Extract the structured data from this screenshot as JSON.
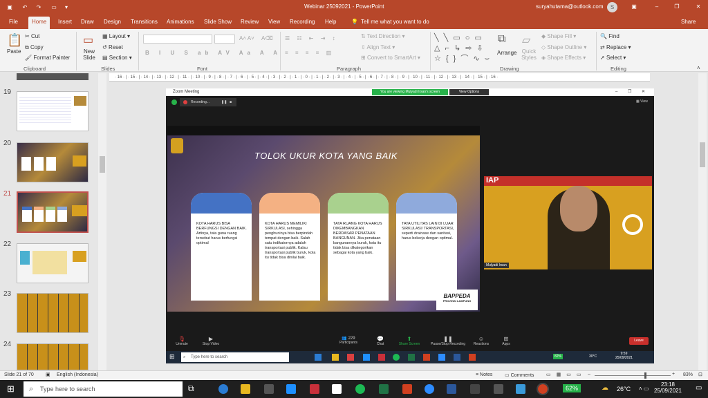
{
  "window": {
    "title": "Webinar 25092021  -  PowerPoint",
    "user": "suryahutama@outlook.com",
    "avatar": "S"
  },
  "tabs": [
    "File",
    "Home",
    "Insert",
    "Draw",
    "Design",
    "Transitions",
    "Animations",
    "Slide Show",
    "Review",
    "View",
    "Recording",
    "Help"
  ],
  "tell_me": "Tell me what you want to do",
  "share": "Share",
  "clipboard": {
    "paste": "Paste",
    "cut": "Cut",
    "copy": "Copy",
    "painter": "Format Painter",
    "label": "Clipboard"
  },
  "slides": {
    "new": "New Slide",
    "layout": "Layout",
    "reset": "Reset",
    "section": "Section",
    "label": "Slides"
  },
  "font_label": "Font",
  "paragraph": {
    "dir": "Text Direction",
    "align": "Align Text",
    "smart": "Convert to SmartArt",
    "label": "Paragraph"
  },
  "drawing": {
    "arrange": "Arrange",
    "quick": "Quick Styles",
    "fill": "Shape Fill",
    "outline": "Shape Outline",
    "effects": "Shape Effects",
    "label": "Drawing"
  },
  "editing": {
    "find": "Find",
    "replace": "Replace",
    "select": "Select",
    "label": "Editing"
  },
  "ruler": "· 16 · | · 15 · | · 14 · | · 13 · | · 12 · | · 11 · | · 10 · | · 9 · | · 8 · | · 7 · | · 6 · | · 5 · | · 4 · | · 3 · | · 2 · | · 1 · | · 0 · | · 1 · | · 2 · | · 3 · | · 4 · | · 5 · | · 6 · | · 7 · | · 8 · | · 9 · | · 10 · | · 11 · | · 12 · | · 13 · | · 14 · | · 15 · | · 16 ·",
  "thumbnails": [
    "19",
    "20",
    "21",
    "22",
    "23",
    "24"
  ],
  "zoom": {
    "title": "Zoom Meeting",
    "viewing": "You are viewing Mulyadi Irsan's screen",
    "options": "View Options",
    "recording": "Recording...",
    "view": "View",
    "slide_title": "TOLOK UKUR KOTA YANG BAIK",
    "card1": "KOTA HARUS BISA BERFUNGSI DENGAN BAIK. Artinya, tata guna ruang tersebut harus berfungsi optimal",
    "card2": "KOTA HARUS MEMILIKI SIRKULASI, sehingga penghuninya bisa berpindah tempat dengan baik. Salah satu indikatornya adalah transportasi publik. Kalau transportasi publik buruk, kota itu tidak bisa dinilai baik.",
    "card3": "TATA RUANG KOTA HARUS DIKEMBANGKAN BERDASAR PENATAAN BANGUNAN. Jika penataan bangunannya buruk, kota itu tidak bisa dikategorikan sebagai kota yang baik.",
    "card4": "TATA UTILITAS LAIN DI LUAR SIRKULASI/ TRANSPORTASI, seperti drainase dan sanitasi, harus bekerja dengan optimal.",
    "bappeda": "BAPPEDA",
    "provinsi": "PROVINSI LAMPUNG",
    "iap": "IAP",
    "speaker": "Mulyadi Irsan",
    "controls": [
      "Unmute",
      "Stop Video",
      "Participants",
      "Chat",
      "Share Screen",
      "Pause/Stop Recording",
      "Reactions",
      "Apps"
    ],
    "participants": "229",
    "leave": "Leave",
    "inner_search": "Type here to search",
    "inner_battery": "82%",
    "inner_temp": "30°C",
    "inner_time": "9:59",
    "inner_date": "25/09/2021"
  },
  "status": {
    "slide": "Slide 21 of 70",
    "lang": "English (Indonesia)",
    "notes": "Notes",
    "comments": "Comments",
    "zoom": "83%"
  },
  "taskbar": {
    "search": "Type here to search",
    "battery": "62%",
    "temp": "26°C",
    "time": "23:18",
    "date": "25/09/2021"
  }
}
